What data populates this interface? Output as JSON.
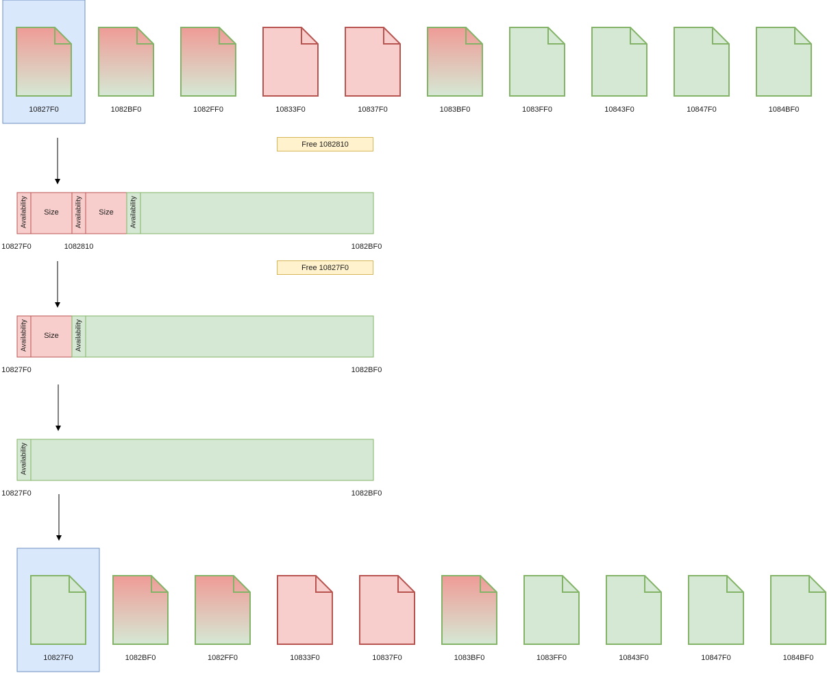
{
  "colors": {
    "used_fill": "#f8cecc",
    "used_stroke": "#b85450",
    "free_fill": "#d5e8d4",
    "free_stroke": "#82b366",
    "partial_top": "#ef9b96",
    "selection_fill": "#dae8fc",
    "selection_stroke": "#6c8ebf",
    "note_fill": "#fff2cc",
    "note_stroke": "#d6b656"
  },
  "pages_top": [
    {
      "address": "10827F0",
      "state": "partial",
      "selected": true
    },
    {
      "address": "1082BF0",
      "state": "partial"
    },
    {
      "address": "1082FF0",
      "state": "partial"
    },
    {
      "address": "10833F0",
      "state": "used"
    },
    {
      "address": "10837F0",
      "state": "used"
    },
    {
      "address": "1083BF0",
      "state": "partial"
    },
    {
      "address": "1083FF0",
      "state": "free"
    },
    {
      "address": "10843F0",
      "state": "free"
    },
    {
      "address": "10847F0",
      "state": "free"
    },
    {
      "address": "1084BF0",
      "state": "free"
    }
  ],
  "pages_bottom": [
    {
      "address": "10827F0",
      "state": "free",
      "selected": true
    },
    {
      "address": "1082BF0",
      "state": "partial"
    },
    {
      "address": "1082FF0",
      "state": "partial"
    },
    {
      "address": "10833F0",
      "state": "used"
    },
    {
      "address": "10837F0",
      "state": "used"
    },
    {
      "address": "1083BF0",
      "state": "partial"
    },
    {
      "address": "1083FF0",
      "state": "free"
    },
    {
      "address": "10843F0",
      "state": "free"
    },
    {
      "address": "10847F0",
      "state": "free"
    },
    {
      "address": "1084BF0",
      "state": "free"
    }
  ],
  "steps": [
    {
      "note": "Free 1082810",
      "cells": [
        {
          "label": "Availability",
          "kind": "used"
        },
        {
          "label": "Size",
          "kind": "used"
        },
        {
          "label": "Availability",
          "kind": "used"
        },
        {
          "label": "Size",
          "kind": "used"
        },
        {
          "label": "Availability",
          "kind": "free"
        },
        {
          "label": "",
          "kind": "free"
        }
      ],
      "addresses": {
        "start": "10827F0",
        "mid": "1082810",
        "end": "1082BF0"
      }
    },
    {
      "note": "Free  10827F0",
      "cells": [
        {
          "label": "Availability",
          "kind": "used"
        },
        {
          "label": "Size",
          "kind": "used"
        },
        {
          "label": "Availability",
          "kind": "free"
        },
        {
          "label": "",
          "kind": "free"
        }
      ],
      "addresses": {
        "start": "10827F0",
        "end": "1082BF0"
      }
    },
    {
      "cells": [
        {
          "label": "Availability",
          "kind": "free"
        },
        {
          "label": "",
          "kind": "free"
        }
      ],
      "addresses": {
        "start": "10827F0",
        "end": "1082BF0"
      }
    }
  ]
}
